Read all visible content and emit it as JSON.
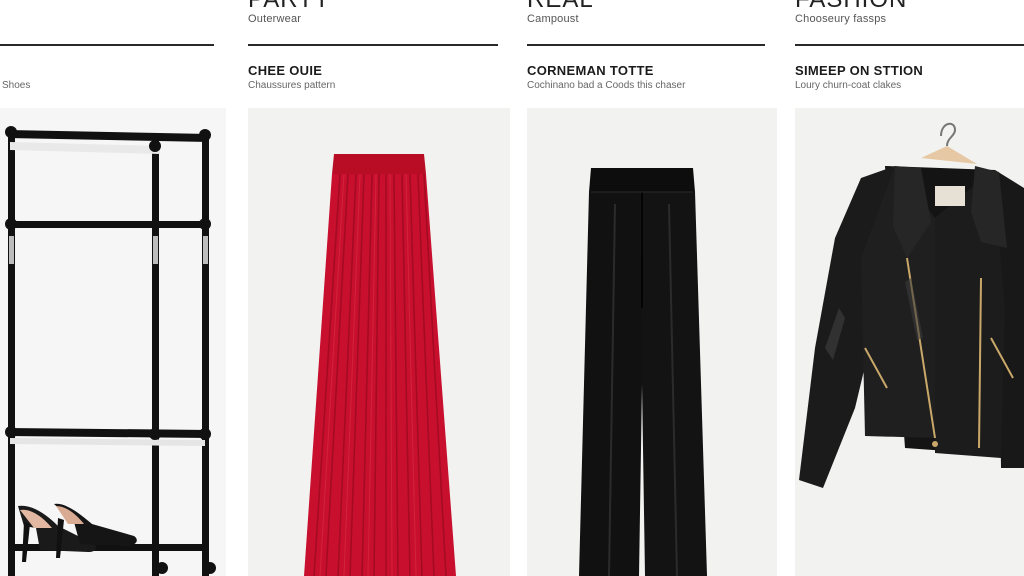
{
  "products": [
    {
      "brand": "",
      "brand_sub": "",
      "title": "",
      "subtitle": "Shoes",
      "image": "clothing-rack-with-heels",
      "icon": "clothing-rack-icon"
    },
    {
      "brand": "PARTY",
      "brand_sub": "Outerwear",
      "title": "CHEE OUIE",
      "subtitle": "Chaussures pattern",
      "image": "red-pleated-maxi-skirt",
      "icon": "skirt-icon"
    },
    {
      "brand": "REAL",
      "brand_sub": "Campoust",
      "title": "CORNEMAN TOTTE",
      "subtitle": "Cochinano bad a Coods this chaser",
      "image": "black-wide-leg-trousers",
      "icon": "trousers-icon"
    },
    {
      "brand": "FASHION",
      "brand_sub": "Chooseury fassps",
      "title": "SIMEEP ON STTION",
      "subtitle": "Loury churn-coat clakes",
      "image": "black-leather-biker-jacket",
      "icon": "jacket-icon"
    }
  ],
  "colors": {
    "skirt": "#c8102e",
    "black": "#111111",
    "panel": "#f2f2f1"
  }
}
